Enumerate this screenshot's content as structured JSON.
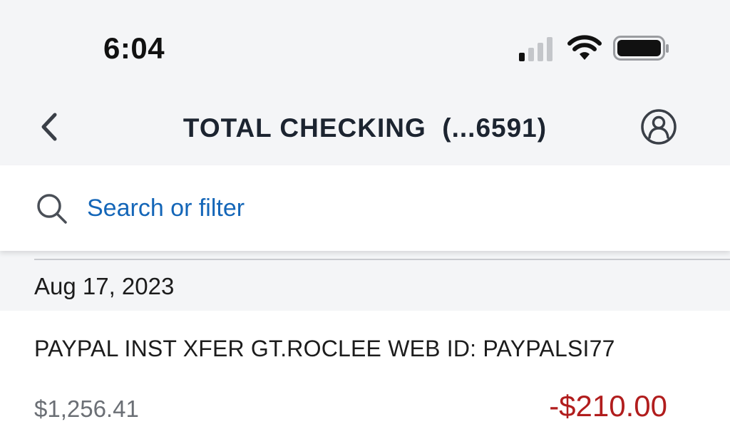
{
  "status_bar": {
    "time": "6:04",
    "icons": [
      "cellular-signal-icon",
      "wifi-icon",
      "battery-icon"
    ]
  },
  "header": {
    "back_icon": "chevron-left-icon",
    "title": "TOTAL CHECKING  (...6591)",
    "profile_icon": "user-profile-icon"
  },
  "search": {
    "icon": "search-icon",
    "placeholder": "Search or filter",
    "value": ""
  },
  "transactions": {
    "groups": [
      {
        "date": "Aug 17, 2023",
        "items": [
          {
            "description": "PAYPAL INST XFER GT.ROCLEE WEB ID: PAYPALSI77",
            "balance": "$1,256.41",
            "amount": "-$210.00"
          }
        ]
      }
    ]
  },
  "colors": {
    "header_background": "#f4f5f7",
    "link_blue": "#1466b8",
    "debit_red": "#b11d1d",
    "title_text": "#1c2430"
  }
}
